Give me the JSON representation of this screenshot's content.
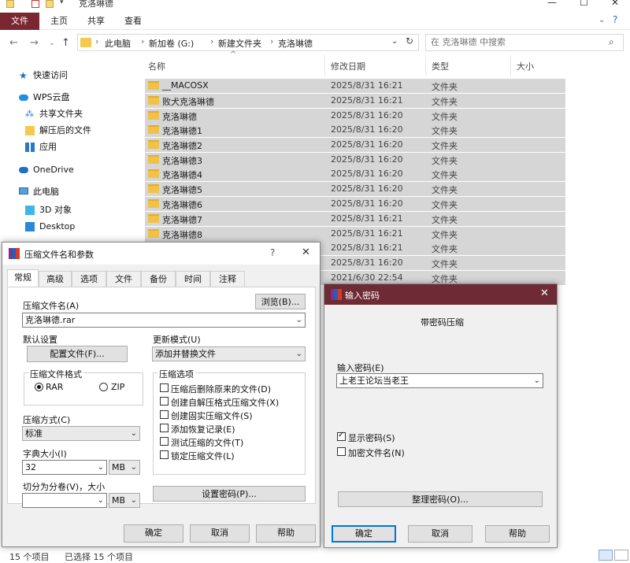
{
  "explorer": {
    "window_title": "克洛琳德",
    "ribbon_tabs": [
      "文件",
      "主页",
      "共享",
      "查看"
    ],
    "breadcrumb": [
      "此电脑",
      "新加卷 (G:)",
      "新建文件夹",
      "克洛琳德"
    ],
    "search_placeholder": "在 克洛琳德 中搜索",
    "nav_items": [
      {
        "label": "快速访问",
        "icon": "star-icon"
      },
      {
        "label": "WPS云盘",
        "icon": "cloud-icon"
      },
      {
        "label": "共享文件夹",
        "icon": "share-icon"
      },
      {
        "label": "解压后的文件",
        "icon": "folder-icon"
      },
      {
        "label": "应用",
        "icon": "apps-icon"
      },
      {
        "label": "OneDrive",
        "icon": "onedrive-icon"
      },
      {
        "label": "此电脑",
        "icon": "pc-icon"
      },
      {
        "label": "3D 对象",
        "icon": "cube-icon"
      },
      {
        "label": "Desktop",
        "icon": "desktop-icon"
      }
    ],
    "columns": {
      "name": "名称",
      "date": "修改日期",
      "type": "类型",
      "size": "大小"
    },
    "files": [
      {
        "name": "__MACOSX",
        "date": "2025/8/31 16:21",
        "type": "文件夹"
      },
      {
        "name": "败犬克洛琳德",
        "date": "2025/8/31 16:21",
        "type": "文件夹"
      },
      {
        "name": "克洛琳德",
        "date": "2025/8/31 16:20",
        "type": "文件夹"
      },
      {
        "name": "克洛琳德1",
        "date": "2025/8/31 16:20",
        "type": "文件夹"
      },
      {
        "name": "克洛琳德2",
        "date": "2025/8/31 16:20",
        "type": "文件夹"
      },
      {
        "name": "克洛琳德3",
        "date": "2025/8/31 16:20",
        "type": "文件夹"
      },
      {
        "name": "克洛琳德4",
        "date": "2025/8/31 16:20",
        "type": "文件夹"
      },
      {
        "name": "克洛琳德5",
        "date": "2025/8/31 16:20",
        "type": "文件夹"
      },
      {
        "name": "克洛琳德6",
        "date": "2025/8/31 16:20",
        "type": "文件夹"
      },
      {
        "name": "克洛琳德7",
        "date": "2025/8/31 16:21",
        "type": "文件夹"
      },
      {
        "name": "克洛琳德8",
        "date": "2025/8/31 16:21",
        "type": "文件夹"
      },
      {
        "name": "",
        "date": "2025/8/31 16:21",
        "type": "文件夹"
      },
      {
        "name": "",
        "date": "2025/8/31 16:20",
        "type": "文件夹"
      },
      {
        "name": "",
        "date": "2021/6/30 22:54",
        "type": "文件夹"
      }
    ],
    "status": {
      "count": "15 个项目",
      "selected": "已选择 15 个项目"
    }
  },
  "rar_dialog": {
    "title": "压缩文件名和参数",
    "help_glyph": "?",
    "close_glyph": "✕",
    "tabs": [
      "常规",
      "高级",
      "选项",
      "文件",
      "备份",
      "时间",
      "注释"
    ],
    "archive_name_label": "压缩文件名(A)",
    "browse_label": "浏览(B)...",
    "archive_name_value": "克洛琳德.rar",
    "default_settings_label": "默认设置",
    "profiles_label": "配置文件(F)...",
    "update_mode_label": "更新模式(U)",
    "update_mode_value": "添加并替换文件",
    "format_group_label": "压缩文件格式",
    "format_rar": "RAR",
    "format_zip": "ZIP",
    "options_group_label": "压缩选项",
    "options": [
      {
        "label": "压缩后删除原来的文件(D)",
        "checked": false
      },
      {
        "label": "创建自解压格式压缩文件(X)",
        "checked": false
      },
      {
        "label": "创建固实压缩文件(S)",
        "checked": false
      },
      {
        "label": "添加恢复记录(E)",
        "checked": false
      },
      {
        "label": "测试压缩的文件(T)",
        "checked": false
      },
      {
        "label": "锁定压缩文件(L)",
        "checked": false
      }
    ],
    "method_label": "压缩方式(C)",
    "method_value": "标准",
    "dict_label": "字典大小(I)",
    "dict_value": "32",
    "dict_unit": "MB",
    "split_label": "切分为分卷(V)，大小",
    "split_value": "",
    "split_unit": "MB",
    "set_password_label": "设置密码(P)...",
    "ok_label": "确定",
    "cancel_label": "取消",
    "help_label": "帮助"
  },
  "pw_dialog": {
    "title": "输入密码",
    "close_glyph": "✕",
    "heading": "带密码压缩",
    "password_label": "输入密码(E)",
    "password_value": "上老王论坛当老王",
    "show_password_label": "显示密码(S)",
    "show_password_checked": true,
    "encrypt_names_label": "加密文件名(N)",
    "encrypt_names_checked": false,
    "organize_label": "整理密码(O)...",
    "ok_label": "确定",
    "cancel_label": "取消",
    "help_label": "帮助"
  },
  "colors": {
    "accent": "#7a2731",
    "pw_titlebar": "#6e2a35",
    "selection": "#d6d6d6"
  }
}
